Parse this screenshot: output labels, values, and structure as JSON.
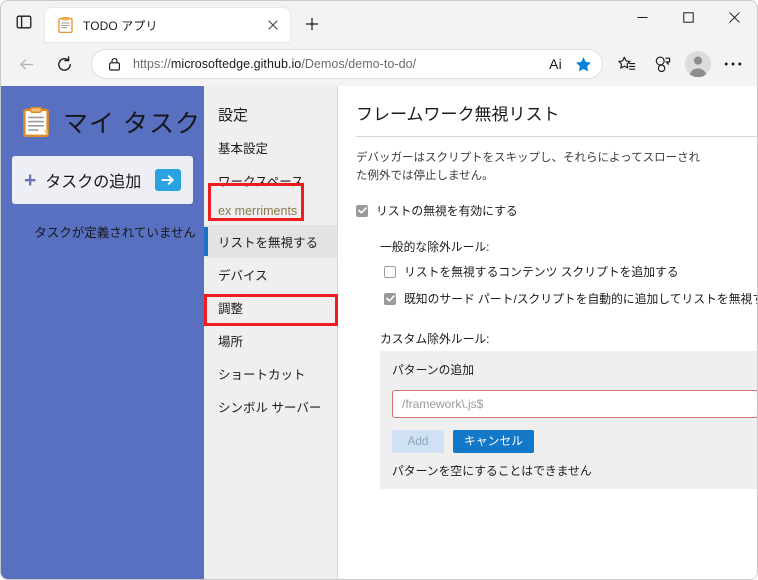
{
  "browser": {
    "tab_sidebar_icon": "tab-sidebar-icon",
    "tab": {
      "favicon": "clipboard-icon",
      "title": "TODO アプリ",
      "close_icon": "close-icon"
    },
    "new_tab_icon": "plus-icon",
    "window_controls": {
      "minimize": "minimize-icon",
      "maximize": "maximize-icon",
      "close": "close-icon"
    },
    "nav": {
      "back_icon": "back-arrow-icon",
      "reload_icon": "reload-icon"
    },
    "omnibox": {
      "lock_icon": "lock-icon",
      "url_prefix": "https://",
      "url_domain": "microsoftedge.github.io",
      "url_path": "/Demos/demo-to-do/",
      "ai_label": "Ai",
      "star_icon": "star-filled-icon",
      "star_color": "#0a84d8"
    },
    "toolbar": {
      "collections_icon": "collections-icon",
      "split_screen_icon": "split-screen-icon",
      "profile_icon": "profile-avatar-icon",
      "more_icon": "more-ellipsis-icon"
    }
  },
  "todo_app": {
    "icon": "clipboard-icon",
    "title": "マイ タスク",
    "add_task": {
      "plus": "+",
      "label": "タスクの追加",
      "submit_icon": "arrow-right-icon"
    },
    "empty_message": "タスクが定義されていません",
    "background_color": "#5870bf"
  },
  "devtools_settings": {
    "nav_title": "設定",
    "nav_items": [
      {
        "label": "基本設定",
        "state": "normal"
      },
      {
        "label": "ワークスペース",
        "state": "normal"
      },
      {
        "label": "ex merriments",
        "state": "faded"
      },
      {
        "label": "リストを無視する",
        "state": "selected"
      },
      {
        "label": "デバイス",
        "state": "normal"
      },
      {
        "label": "調整",
        "state": "normal"
      },
      {
        "label": "場所",
        "state": "normal"
      },
      {
        "label": "ショートカット",
        "state": "normal"
      },
      {
        "label": "シンボル サーバー",
        "state": "normal"
      }
    ],
    "pane": {
      "close_icon": "close-icon",
      "title": "フレームワーク無視リスト",
      "description": "デバッガーはスクリプトをスキップし、それらによってスローされた例外では停止しません。",
      "enable_checkbox": {
        "label": "リストの無視を有効にする",
        "checked": true
      },
      "general_rules_label": "一般的な除外ルール:",
      "general_rules": [
        {
          "label": "リストを無視するコンテンツ スクリプトを追加する",
          "checked": false
        },
        {
          "label": "既知のサード パート/スクリプトを自動的に追加してリストを無視する",
          "checked": true
        }
      ],
      "custom_rules_label": "カスタム除外ルール:",
      "custom_card": {
        "heading": "パターンの追加",
        "input_placeholder": "/framework\\.js$",
        "input_value": "",
        "input_border_color": "#d9736b",
        "add_button": "Add",
        "cancel_button": "キャンセル",
        "cancel_button_color": "#1478c8",
        "error_message": "パターンを空にすることはできません"
      }
    }
  },
  "annotations": {
    "highlight_color": "#ee1b20",
    "boxes": [
      {
        "name": "settings-title-highlight"
      },
      {
        "name": "ignore-list-item-highlight"
      }
    ]
  }
}
